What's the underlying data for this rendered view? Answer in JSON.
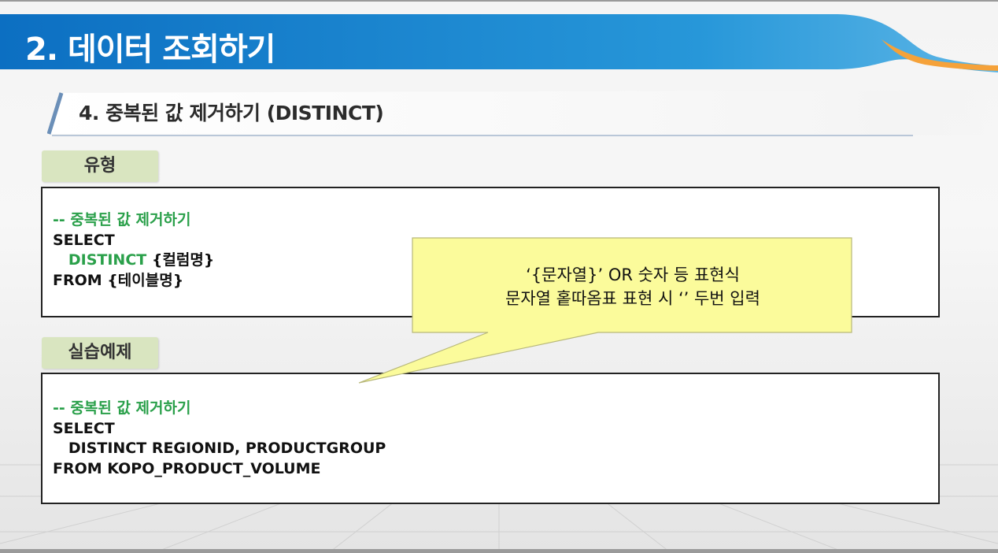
{
  "page_title": "2. 데이터 조회하기",
  "section_title": "4. 중복된 값 제거하기 (DISTINCT)",
  "type_section": {
    "label": "유형",
    "code": {
      "comment": "-- 중복된 값 제거하기",
      "select": "SELECT",
      "indent": "   ",
      "distinct": "DISTINCT",
      "column_placeholder": " {컬럼명}",
      "from": "FROM {테이블명}"
    }
  },
  "example_section": {
    "label": "실습예제",
    "code": {
      "comment": "-- 중복된 값 제거하기",
      "select": "SELECT",
      "distinct_line": "   DISTINCT REGIONID, PRODUCTGROUP",
      "from": "FROM KOPO_PRODUCT_VOLUME"
    }
  },
  "callout": {
    "line1": "‘{문자열}’ OR 숫자 등 표현식",
    "line2": "문자열 홑따옴표 표현 시 ‘’ 두번 입력"
  },
  "colors": {
    "header_blue": "#1e8fd6",
    "header_orange": "#f5a23a",
    "comment_green": "#2aa04a",
    "tag_green": "#d9e5c0",
    "callout_yellow": "#fbfb9b"
  }
}
